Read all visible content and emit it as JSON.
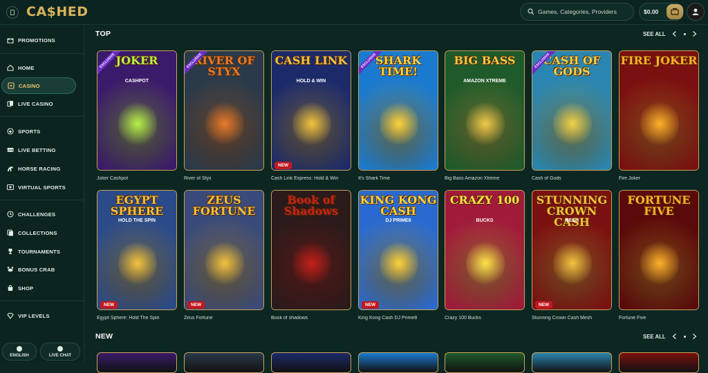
{
  "header": {
    "logo": "CA$HED",
    "search_placeholder": "Games, Categories, Providers",
    "balance": "$0.00"
  },
  "sidebar": {
    "items": [
      {
        "label": "PROMOTIONS",
        "icon": "gift-icon"
      },
      {
        "label": "HOME",
        "icon": "home-icon"
      },
      {
        "label": "CASINO",
        "icon": "casino-icon",
        "active": true
      },
      {
        "label": "LIVE CASINO",
        "icon": "cards-icon"
      },
      {
        "label": "SPORTS",
        "icon": "sports-icon"
      },
      {
        "label": "LIVE BETTING",
        "icon": "live-icon"
      },
      {
        "label": "HORSE RACING",
        "icon": "horse-icon"
      },
      {
        "label": "VIRTUAL SPORTS",
        "icon": "virtual-icon"
      },
      {
        "label": "CHALLENGES",
        "icon": "challenge-icon"
      },
      {
        "label": "COLLECTIONS",
        "icon": "collection-icon"
      },
      {
        "label": "TOURNAMENTS",
        "icon": "trophy-icon"
      },
      {
        "label": "BONUS CRAB",
        "icon": "crab-icon"
      },
      {
        "label": "SHOP",
        "icon": "shop-icon"
      },
      {
        "label": "VIP LEVELS",
        "icon": "diamond-icon"
      }
    ],
    "language": "ENGLISH",
    "live_chat": "LIVE CHAT"
  },
  "sections": [
    {
      "title": "TOP",
      "see_all": "SEE ALL"
    },
    {
      "title": "NEW",
      "see_all": "SEE ALL"
    }
  ],
  "top_games": [
    {
      "name": "Joker Cashpot",
      "art": "JOKER",
      "sub": "CASHPOT",
      "exclusive": true,
      "new": false,
      "bg": "#3a1a6a",
      "accent": "#b8f04a"
    },
    {
      "name": "River of Styx",
      "art": "RIVER OF STYX",
      "sub": "",
      "exclusive": true,
      "new": false,
      "bg": "#2a3a4a",
      "accent": "#e87a2a"
    },
    {
      "name": "Cash Link Express: Hold & Win",
      "art": "CASH LINK",
      "sub": "HOLD & WIN",
      "exclusive": false,
      "new": true,
      "bg": "#1c2a6a",
      "accent": "#f3c240"
    },
    {
      "name": "It's Shark Time",
      "art": "SHARK TIME!",
      "sub": "",
      "exclusive": true,
      "new": false,
      "bg": "#1a7ad0",
      "accent": "#ffd23a"
    },
    {
      "name": "Big Bass Amazon Xtreme",
      "art": "BIG BASS",
      "sub": "AMAZON XTREME",
      "exclusive": false,
      "new": false,
      "bg": "#1f5a2a",
      "accent": "#f2c84a"
    },
    {
      "name": "Cash of Gods",
      "art": "CASH OF GODS",
      "sub": "",
      "exclusive": true,
      "new": false,
      "bg": "#2a86b0",
      "accent": "#f3d24a"
    },
    {
      "name": "Fire Joker",
      "art": "FIRE JOKER",
      "sub": "",
      "exclusive": false,
      "new": false,
      "bg": "#7a1010",
      "accent": "#ffb02a"
    }
  ],
  "second_games": [
    {
      "name": "Egypt Sphere: Hold The Spin",
      "art": "EGYPT SPHERE",
      "sub": "HOLD THE SPIN",
      "exclusive": false,
      "new": true,
      "bg": "#2a4a8a",
      "accent": "#f3c240"
    },
    {
      "name": "Zeus Fortune",
      "art": "ZEUS FORTUNE",
      "sub": "",
      "exclusive": false,
      "new": true,
      "bg": "#3a4a7a",
      "accent": "#f3c240"
    },
    {
      "name": "Book of shadows",
      "art": "Book of Shadows",
      "sub": "",
      "exclusive": false,
      "new": false,
      "bg": "#2a1a1a",
      "accent": "#c4201a"
    },
    {
      "name": "King Kong Cash DJ Prime8",
      "art": "KING KONG CASH",
      "sub": "DJ PRIME8",
      "exclusive": false,
      "new": true,
      "bg": "#2a6ad0",
      "accent": "#ffd23a"
    },
    {
      "name": "Crazy 100 Bucks",
      "art": "CRAZY 100",
      "sub": "BUCKS",
      "exclusive": false,
      "new": false,
      "bg": "#a01a3a",
      "accent": "#ffe24a"
    },
    {
      "name": "Stunning Crown Cash Mesh",
      "art": "STUNNING CROWN CASH",
      "sub": "MESH",
      "exclusive": false,
      "new": true,
      "bg": "#7a1010",
      "accent": "#f3c240"
    },
    {
      "name": "Fortune Five",
      "art": "FORTUNE FIVE",
      "sub": "",
      "exclusive": false,
      "new": false,
      "bg": "#5a0a0a",
      "accent": "#ffb02a"
    }
  ],
  "labels": {
    "exclusive": "EXCLUSIVE",
    "new": "NEW"
  }
}
